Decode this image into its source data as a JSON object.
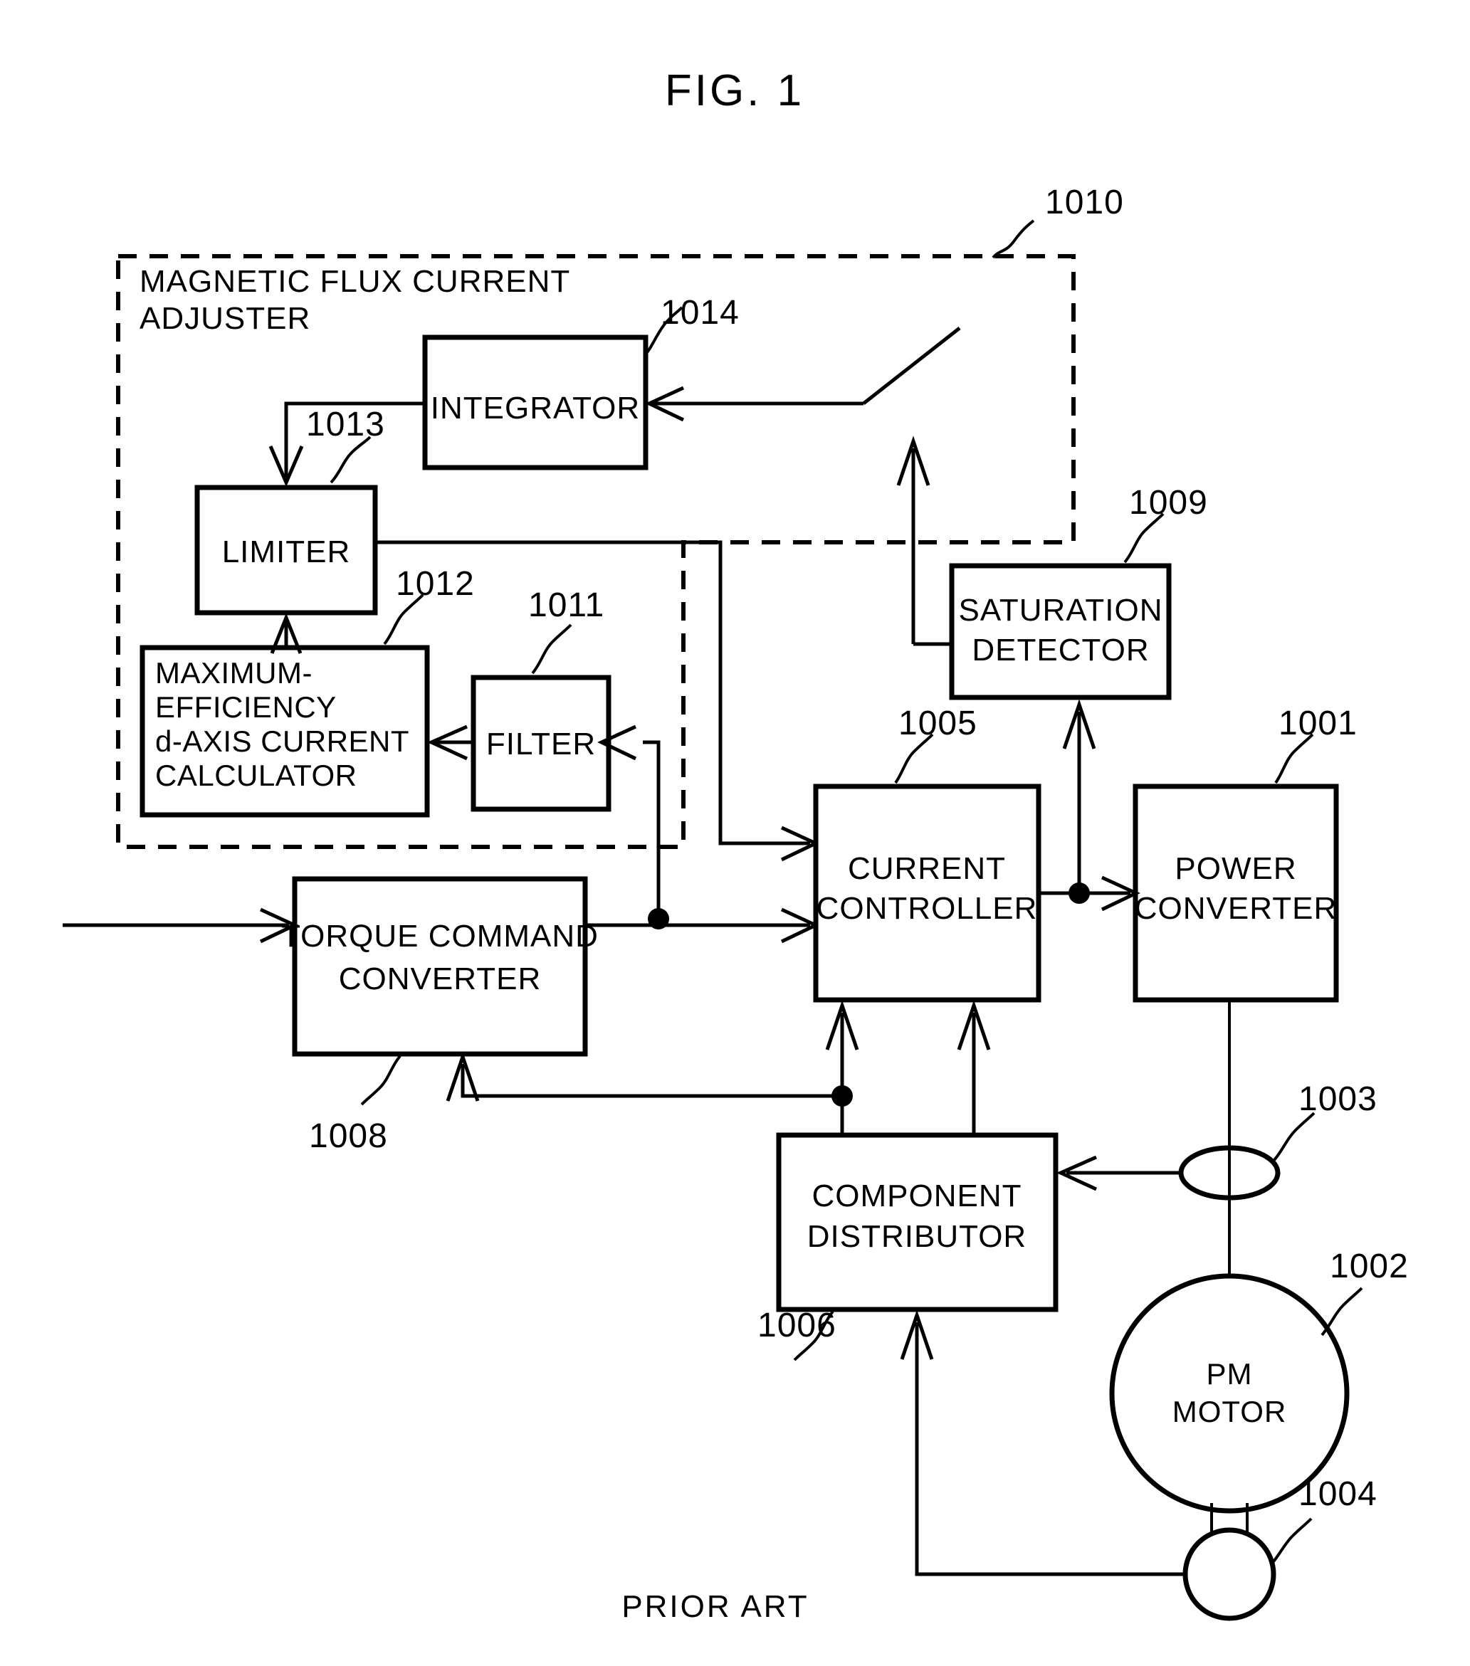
{
  "figure": {
    "title": "FIG. 1",
    "footer": "PRIOR ART"
  },
  "group": {
    "label_line1": "MAGNETIC FLUX CURRENT",
    "label_line2": "ADJUSTER",
    "ref": "1010"
  },
  "blocks": [
    {
      "id": "integrator",
      "label_line1": "INTEGRATOR",
      "label_line2": "",
      "ref": "1014"
    },
    {
      "id": "limiter",
      "label_line1": "LIMITER",
      "label_line2": "",
      "ref": "1013"
    },
    {
      "id": "max_eff_calc",
      "label_line1": "MAXIMUM-",
      "label_line2": "EFFICIENCY",
      "label_line3": "d-AXIS CURRENT",
      "label_line4": "CALCULATOR",
      "ref": "1012"
    },
    {
      "id": "filter",
      "label_line1": "FILTER",
      "label_line2": "",
      "ref": "1011"
    },
    {
      "id": "torque_cmd_conv",
      "label_line1": "TORQUE COMMAND",
      "label_line2": "CONVERTER",
      "ref": "1008"
    },
    {
      "id": "saturation_det",
      "label_line1": "SATURATION",
      "label_line2": "DETECTOR",
      "ref": "1009"
    },
    {
      "id": "current_ctrl",
      "label_line1": "CURRENT",
      "label_line2": "CONTROLLER",
      "ref": "1005"
    },
    {
      "id": "power_conv",
      "label_line1": "POWER",
      "label_line2": "CONVERTER",
      "ref": "1001"
    },
    {
      "id": "component_dist",
      "label_line1": "COMPONENT",
      "label_line2": "DISTRIBUTOR",
      "ref": "1006"
    },
    {
      "id": "pm_motor",
      "label_line1": "PM",
      "label_line2": "MOTOR",
      "ref": "1002"
    },
    {
      "id": "current_sensor",
      "label_line1": "",
      "label_line2": "",
      "ref": "1003"
    },
    {
      "id": "encoder",
      "label_line1": "",
      "label_line2": "",
      "ref": "1004"
    }
  ],
  "colors": {
    "line": "#000000",
    "background": "#ffffff",
    "text": "#000000"
  }
}
